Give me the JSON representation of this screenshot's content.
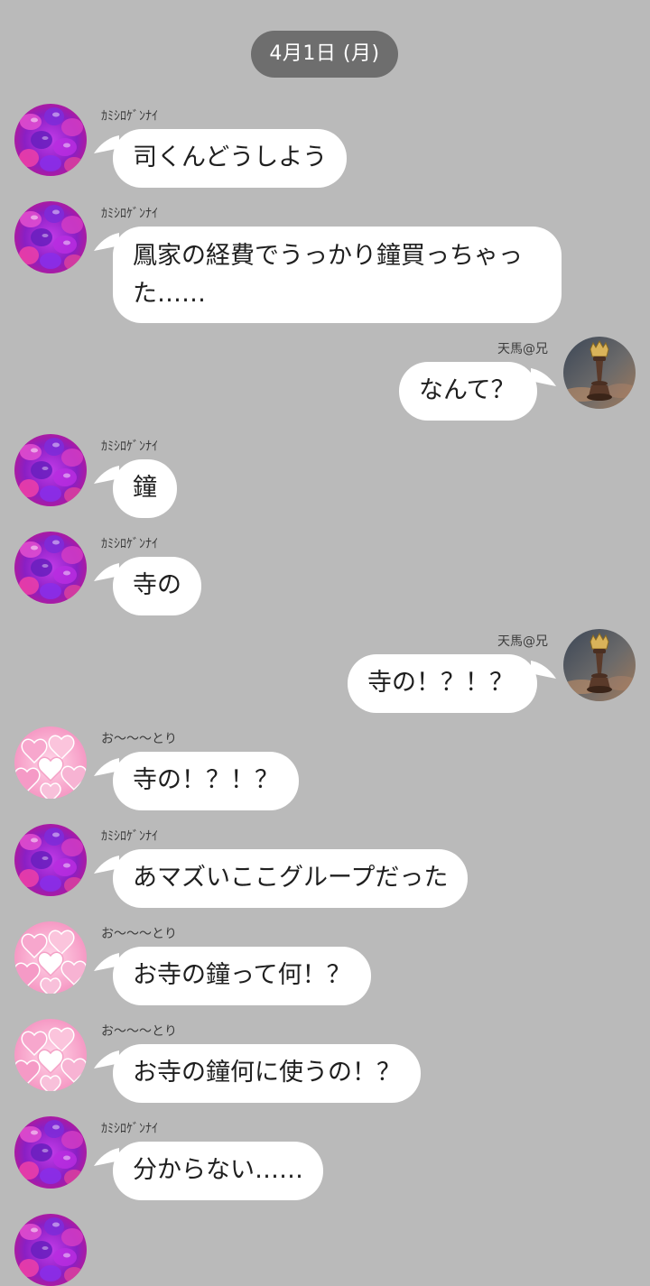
{
  "date_header": "4月1日 (月)",
  "senders": {
    "kamishiro": "ｶﾐｼﾛｹﾞﾝﾅｲ",
    "tenma": "天馬@兄",
    "otori": "お〜〜〜とり"
  },
  "messages": [
    {
      "sender": "ｶﾐｼﾛｹﾞﾝﾅｲ",
      "text": "司くんどうしよう",
      "side": "left",
      "avatar": "purple-gummy-avatar"
    },
    {
      "sender": "ｶﾐｼﾛｹﾞﾝﾅｲ",
      "text_line1": "鳳家の経費でうっかり鐘買っちゃっ",
      "text_line2": "た……",
      "side": "left",
      "avatar": "purple-gummy-avatar"
    },
    {
      "sender": "天馬@兄",
      "text": "なんて？",
      "side": "right",
      "avatar": "chess-crown-avatar"
    },
    {
      "sender": "ｶﾐｼﾛｹﾞﾝﾅｲ",
      "text": "鐘",
      "side": "left",
      "avatar": "purple-gummy-avatar"
    },
    {
      "sender": "ｶﾐｼﾛｹﾞﾝﾅｲ",
      "text": "寺の",
      "side": "left",
      "avatar": "purple-gummy-avatar"
    },
    {
      "sender": "天馬@兄",
      "text": "寺の！？！？",
      "side": "right",
      "avatar": "chess-crown-avatar"
    },
    {
      "sender": "お〜〜〜とり",
      "text": "寺の！？！？",
      "side": "left",
      "avatar": "pink-candy-avatar"
    },
    {
      "sender": "ｶﾐｼﾛｹﾞﾝﾅｲ",
      "text": "あマズいここグループだった",
      "side": "left",
      "avatar": "purple-gummy-avatar"
    },
    {
      "sender": "お〜〜〜とり",
      "text": "お寺の鐘って何！？",
      "side": "left",
      "avatar": "pink-candy-avatar"
    },
    {
      "sender": "お〜〜〜とり",
      "text": "お寺の鐘何に使うの！？",
      "side": "left",
      "avatar": "pink-candy-avatar"
    },
    {
      "sender": "ｶﾐｼﾛｹﾞﾝﾅｲ",
      "text": "分からない……",
      "side": "left",
      "avatar": "purple-gummy-avatar"
    }
  ],
  "colors": {
    "background": "#bababa",
    "bubble": "#ffffff",
    "date_pill": "#6e6e6e",
    "purple_avatar": "#9b2fd6",
    "pink_avatar": "#f59ac6"
  }
}
